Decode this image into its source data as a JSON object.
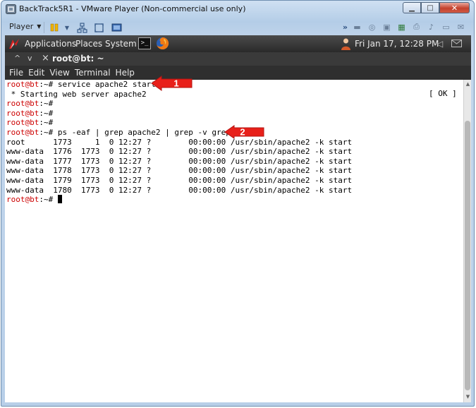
{
  "window": {
    "title": "BackTrack5R1 - VMware Player (Non-commercial use only)"
  },
  "toolbar": {
    "player_label": "Player"
  },
  "gnome_panel": {
    "applications": "Applications",
    "places": "Places",
    "system": "System",
    "clock": "Fri Jan 17, 12:28 PM"
  },
  "terminal_tab": {
    "title": "root@bt: ~"
  },
  "menu": [
    "File",
    "Edit",
    "View",
    "Terminal",
    "Help"
  ],
  "terminal": {
    "prompt": "root@bt",
    "prompt_suffix": ":~#",
    "lines": [
      {
        "type": "prompt",
        "cmd": " service apache2 start"
      },
      {
        "type": "out",
        "text": " * Starting web server apache2"
      },
      {
        "type": "prompt",
        "cmd": ""
      },
      {
        "type": "prompt",
        "cmd": ""
      },
      {
        "type": "prompt",
        "cmd": ""
      },
      {
        "type": "prompt",
        "cmd": " ps -eaf | grep apache2 | grep -v grep"
      },
      {
        "type": "out",
        "text": "root      1773     1  0 12:27 ?        00:00:00 /usr/sbin/apache2 -k start"
      },
      {
        "type": "out",
        "text": "www-data  1776  1773  0 12:27 ?        00:00:00 /usr/sbin/apache2 -k start"
      },
      {
        "type": "out",
        "text": "www-data  1777  1773  0 12:27 ?        00:00:00 /usr/sbin/apache2 -k start"
      },
      {
        "type": "out",
        "text": "www-data  1778  1773  0 12:27 ?        00:00:00 /usr/sbin/apache2 -k start"
      },
      {
        "type": "out",
        "text": "www-data  1779  1773  0 12:27 ?        00:00:00 /usr/sbin/apache2 -k start"
      },
      {
        "type": "out",
        "text": "www-data  1780  1773  0 12:27 ?        00:00:00 /usr/sbin/apache2 -k start"
      },
      {
        "type": "prompt",
        "cmd": " ",
        "cursor": true
      }
    ],
    "status_ok": "[ OK ]"
  },
  "annotations": [
    {
      "label": "1"
    },
    {
      "label": "2"
    }
  ],
  "colors": {
    "prompt": "#cc0000",
    "callout": "#e8201a"
  }
}
